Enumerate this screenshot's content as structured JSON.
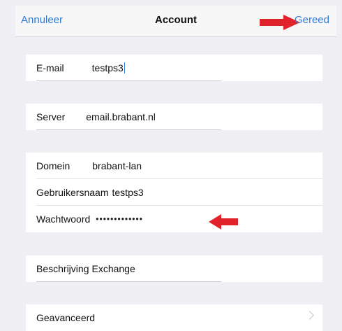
{
  "nav": {
    "cancel_label": "Annuleer",
    "title": "Account",
    "done_label": "Gereed"
  },
  "groups": {
    "email": {
      "label": "E-mail",
      "value": "testps3"
    },
    "server": {
      "label": "Server",
      "value": "email.brabant.nl"
    },
    "credentials": [
      {
        "label": "Domein",
        "value": "brabant-lan"
      },
      {
        "label": "Gebruikersnaam",
        "value": "testps3"
      },
      {
        "label": "Wachtwoord",
        "value": "•••••••••••••"
      }
    ],
    "description": {
      "label": "Beschrijving",
      "value": "Exchange"
    },
    "advanced": {
      "label": "Geavanceerd"
    }
  },
  "colors": {
    "accent": "#2f7bd8",
    "annotation_arrow": "#e0222b",
    "background": "#efeff4"
  },
  "icons": {
    "advanced_chevron": "chevron-right-icon",
    "annotation": "red-arrow-icon"
  }
}
